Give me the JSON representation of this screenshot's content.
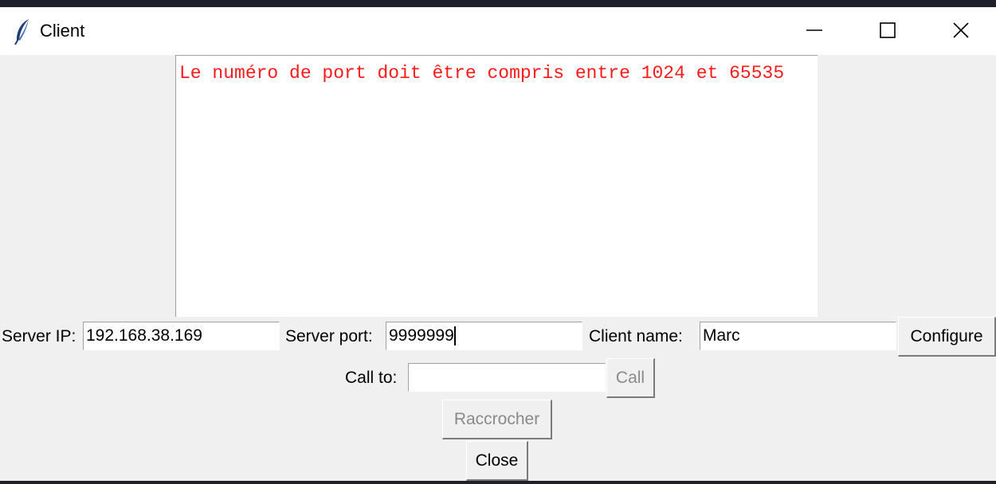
{
  "window": {
    "title": "Client",
    "icon": "feather-icon",
    "controls": [
      "minimize-icon",
      "maximize-icon",
      "close-icon"
    ]
  },
  "log": {
    "message": "Le numéro de port doit être compris entre 1024 et 65535",
    "color": "#ff1a1a"
  },
  "config": {
    "server_ip_label": "Server IP:",
    "server_ip_value": "192.168.38.169",
    "server_port_label": "Server port:",
    "server_port_value": "9999999",
    "client_name_label": "Client name:",
    "client_name_value": "Marc",
    "configure_label": "Configure"
  },
  "call": {
    "call_to_label": "Call to:",
    "call_to_value": "",
    "call_button_label": "Call",
    "hangup_button_label": "Raccrocher"
  },
  "footer": {
    "close_button_label": "Close"
  }
}
